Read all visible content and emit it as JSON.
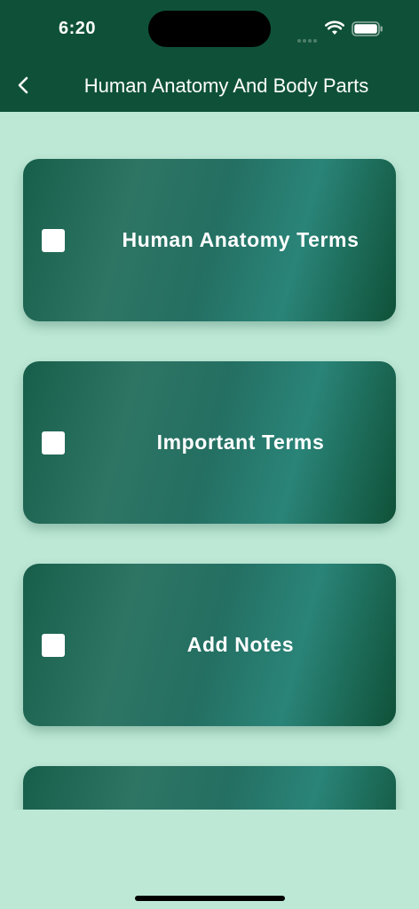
{
  "status_bar": {
    "time": "6:20",
    "icons": [
      "cellular-signal-icon",
      "wifi-icon",
      "battery-icon"
    ]
  },
  "nav": {
    "back_icon": "chevron-left-icon",
    "title": "Human Anatomy And Body Parts"
  },
  "cards": [
    {
      "label": "Human Anatomy Terms",
      "checked": false
    },
    {
      "label": "Important Terms",
      "checked": false
    },
    {
      "label": "Add Notes",
      "checked": false
    },
    {
      "label": "",
      "checked": false
    }
  ],
  "colors": {
    "header": "#0f5138",
    "background": "#bde8d6",
    "card_dark": "#0f5138",
    "card_light": "#2e7564",
    "text": "#ffffff"
  }
}
